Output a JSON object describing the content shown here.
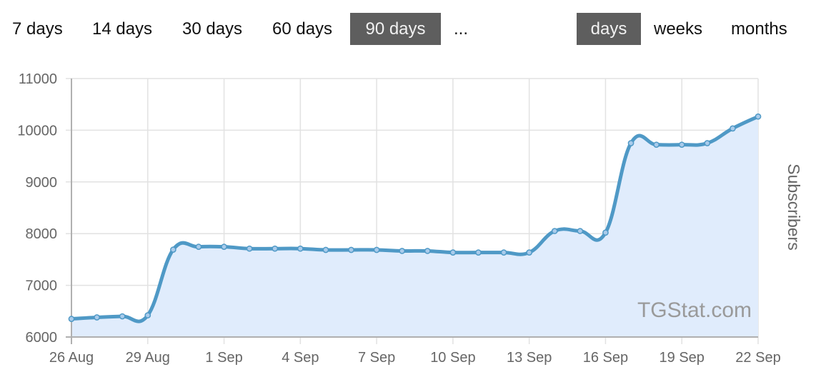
{
  "range_selector": {
    "options": [
      {
        "label": "7 days",
        "active": false
      },
      {
        "label": "14 days",
        "active": false
      },
      {
        "label": "30 days",
        "active": false
      },
      {
        "label": "60 days",
        "active": false
      },
      {
        "label": "90 days",
        "active": true
      },
      {
        "label": "...",
        "active": false
      }
    ]
  },
  "granularity_selector": {
    "options": [
      {
        "label": "days",
        "active": true
      },
      {
        "label": "weeks",
        "active": false
      },
      {
        "label": "months",
        "active": false
      }
    ]
  },
  "watermark": "TGStat.com",
  "colors": {
    "line": "#4f99c6",
    "fill": "#e0ecfc",
    "point_fill": "#a9cbeb",
    "grid": "#e2e2e2",
    "axis": "#b0b0b0",
    "active_button_bg": "#5e5e5e"
  },
  "chart_data": {
    "type": "area",
    "title": "",
    "xlabel": "",
    "ylabel": "Subscribers",
    "ylabel_position": "right",
    "ylim": [
      6000,
      11000
    ],
    "yticks": [
      6000,
      7000,
      8000,
      9000,
      10000,
      11000
    ],
    "grid": true,
    "xtick_labels": [
      "26 Aug",
      "29 Aug",
      "1 Sep",
      "4 Sep",
      "7 Sep",
      "10 Sep",
      "13 Sep",
      "16 Sep",
      "19 Sep",
      "22 Sep"
    ],
    "xtick_every_n_days": 3,
    "x": [
      "26 Aug",
      "27 Aug",
      "28 Aug",
      "29 Aug",
      "30 Aug",
      "31 Aug",
      "1 Sep",
      "2 Sep",
      "3 Sep",
      "4 Sep",
      "5 Sep",
      "6 Sep",
      "7 Sep",
      "8 Sep",
      "9 Sep",
      "10 Sep",
      "11 Sep",
      "12 Sep",
      "13 Sep",
      "14 Sep",
      "15 Sep",
      "16 Sep",
      "17 Sep",
      "18 Sep",
      "19 Sep",
      "20 Sep",
      "21 Sep",
      "22 Sep"
    ],
    "series": [
      {
        "name": "Subscribers",
        "values": [
          6350,
          6380,
          6400,
          6420,
          7690,
          7745,
          7745,
          7710,
          7710,
          7710,
          7685,
          7685,
          7685,
          7665,
          7665,
          7635,
          7635,
          7635,
          7635,
          8050,
          8050,
          8020,
          9750,
          9720,
          9720,
          9750,
          10035,
          10265
        ]
      }
    ]
  }
}
